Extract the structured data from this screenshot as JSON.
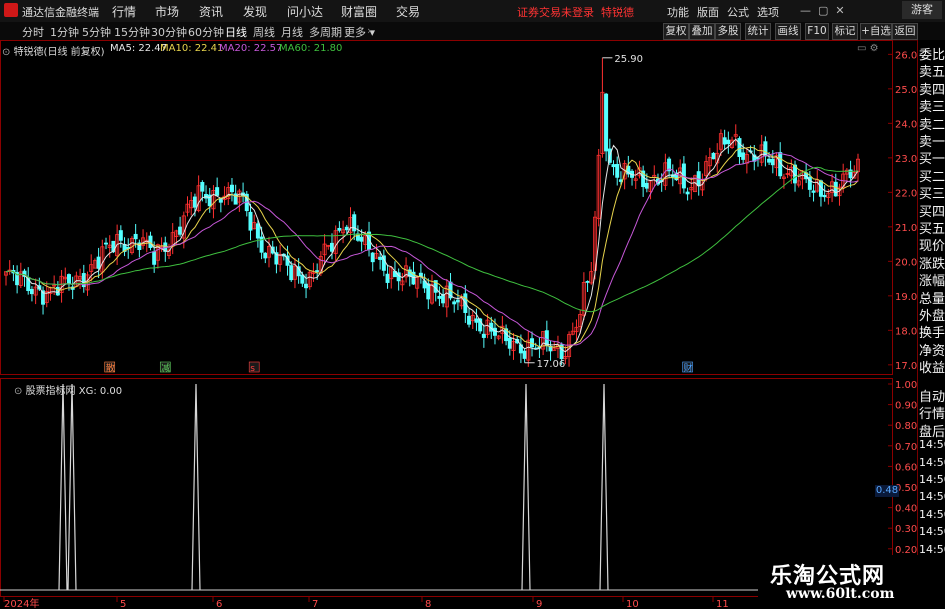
{
  "app": {
    "name": "通达信金融终端",
    "menus": [
      "行情",
      "市场",
      "资讯",
      "发现",
      "问小达",
      "财富圈",
      "交易"
    ],
    "alert": "证券交易未登录",
    "alert_stock": "特锐德",
    "right_menus": [
      "功能",
      "版面",
      "公式",
      "选项"
    ],
    "visitor": "游客"
  },
  "toolbar": {
    "periods": [
      "分时",
      "1分钟",
      "5分钟",
      "15分钟",
      "30分钟",
      "60分钟",
      "日线",
      "周线",
      "月线",
      "多周期",
      "更多"
    ],
    "active_period": "日线",
    "buttons": [
      "复权",
      "叠加",
      "多股",
      "统计",
      "画线",
      "F10",
      "标记",
      "+自选",
      "返回"
    ]
  },
  "main_chart": {
    "stock_label": "特锐德(日线 前复权)",
    "ma": [
      {
        "name": "MA5",
        "value": "22.47",
        "color": "#e6e6e6"
      },
      {
        "name": "MA10",
        "value": "22.41",
        "color": "#e8d44d"
      },
      {
        "name": "MA20",
        "value": "22.57",
        "color": "#c658d8"
      },
      {
        "name": "MA60",
        "value": "21.80",
        "color": "#3fbf3f"
      }
    ],
    "y_ticks": [
      "26.00",
      "25.00",
      "24.00",
      "23.00",
      "22.00",
      "21.00",
      "20.00",
      "19.00",
      "18.00",
      "17.00"
    ],
    "y_range": [
      16.85,
      26.3
    ],
    "high_label": "25.90",
    "low_label": "17.06",
    "event_markers": [
      {
        "label": "散",
        "color": "#ff8040"
      },
      {
        "label": "减",
        "color": "#60d060"
      },
      {
        "label": "s",
        "color": "#ff4040"
      },
      {
        "label": "财",
        "color": "#4aa0ff"
      }
    ],
    "up_color": "#ff3030",
    "down_color": "#54ffff"
  },
  "indicator": {
    "label": "股票指标网 XG: 0.00",
    "y_ticks": [
      "1.00",
      "0.90",
      "0.80",
      "0.70",
      "0.60",
      "0.50",
      "0.40",
      "0.30",
      "0.20",
      "0.10"
    ],
    "current_value": "0.48"
  },
  "x_axis": {
    "labels": [
      "2024年",
      "5",
      "6",
      "7",
      "8",
      "9",
      "10",
      "11"
    ]
  },
  "side_panel": {
    "top": [
      "委比",
      "卖五",
      "卖四",
      "卖三",
      "卖二",
      "卖一",
      "买一",
      "买二",
      "买三",
      "买四",
      "买五",
      "现价",
      "涨跌",
      "涨幅",
      "总量",
      "外盘",
      "换手",
      "净资",
      "收益"
    ],
    "bottom": [
      "自动",
      "行情",
      "盘后",
      "14:50",
      "14:50",
      "14:50",
      "14:50",
      "14:50",
      "14:50",
      "14:50",
      "14:50",
      "14:50",
      "14:50"
    ]
  },
  "watermark": {
    "title": "乐淘公式网",
    "url": "www.60lt.com"
  }
}
